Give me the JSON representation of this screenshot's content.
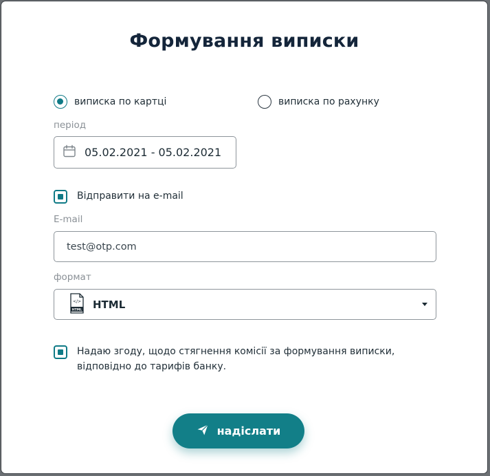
{
  "dialog": {
    "title": "Формування виписки"
  },
  "statement_type": {
    "options": [
      {
        "label": "виписка по картці",
        "selected": true
      },
      {
        "label": "виписка по рахунку",
        "selected": false
      }
    ]
  },
  "period": {
    "label": "період",
    "value": "05.02.2021 - 05.02.2021",
    "icon": "calendar-icon"
  },
  "send_email": {
    "label": "Відправити на e-mail",
    "checked": true
  },
  "email": {
    "label": "E-mail",
    "value": "test@otp.com"
  },
  "format": {
    "label": "формат",
    "value": "HTML",
    "icon": "html-file-icon"
  },
  "consent": {
    "label": "Надаю згоду, щодо стягнення комісії за формування виписки, відповідно до тарифів банку.",
    "checked": true
  },
  "submit": {
    "label": "надіслати",
    "icon": "send-icon"
  },
  "colors": {
    "accent": "#127f88",
    "title": "#14253a",
    "muted_label": "#8a9096"
  }
}
